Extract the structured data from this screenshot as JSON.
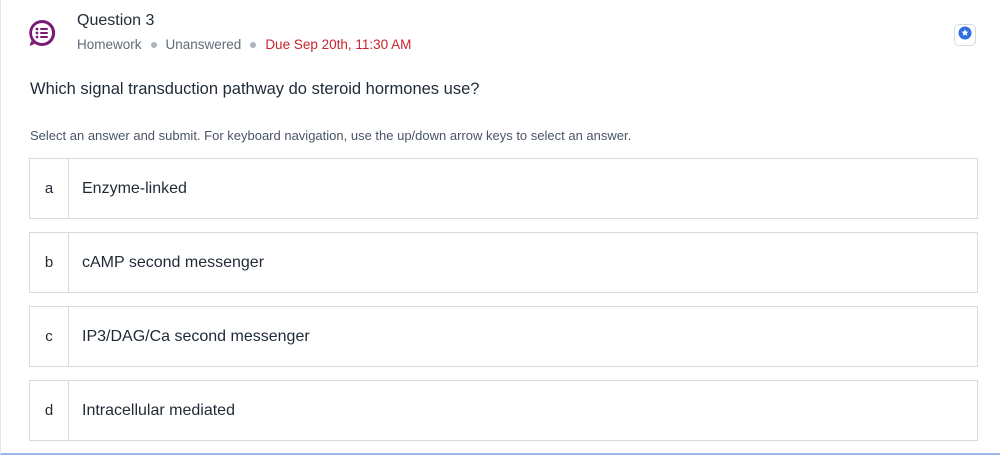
{
  "header": {
    "title": "Question 3",
    "type": "Homework",
    "status": "Unanswered",
    "due": "Due Sep 20th, 11:30 AM",
    "icon": "question-list-icon",
    "bookmark_icon": "star-bookmark-icon"
  },
  "question": {
    "text": "Which signal transduction pathway do steroid hormones use?",
    "instructions": "Select an answer and submit. For keyboard navigation, use the up/down arrow keys to select an answer."
  },
  "options": [
    {
      "letter": "a",
      "text": "Enzyme-linked"
    },
    {
      "letter": "b",
      "text": "cAMP second messenger"
    },
    {
      "letter": "c",
      "text": "IP3/DAG/Ca second messenger"
    },
    {
      "letter": "d",
      "text": "Intracellular mediated"
    }
  ],
  "colors": {
    "accent_purple": "#7a1a74",
    "due_red": "#c8232c",
    "bookmark_blue": "#2f6fe0"
  }
}
